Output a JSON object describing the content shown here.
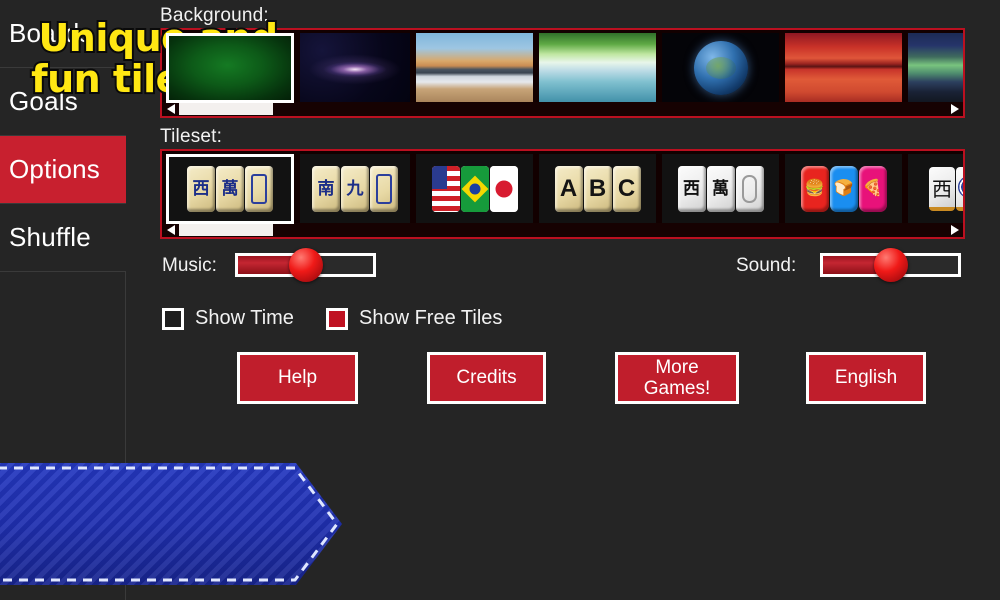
{
  "sidebar": {
    "items": [
      {
        "label": "Boards",
        "selected": false
      },
      {
        "label": "Goals",
        "selected": false
      },
      {
        "label": "Options",
        "selected": true
      },
      {
        "label": "Shuffle",
        "selected": false
      }
    ]
  },
  "background_section": {
    "label": "Background:",
    "selected_index": 0,
    "scroll_left_icon": "left-arrow-icon",
    "scroll_right_icon": "right-arrow-icon",
    "thumbs": [
      {
        "name": "green-felt",
        "style": "bg-green"
      },
      {
        "name": "galaxy",
        "style": "bg-galaxy"
      },
      {
        "name": "beach-sunset",
        "style": "bg-beach"
      },
      {
        "name": "forest-lake",
        "style": "bg-forest"
      },
      {
        "name": "earth-from-space",
        "style": "bg-earth"
      },
      {
        "name": "red-desert",
        "style": "bg-desert"
      },
      {
        "name": "aurora-borealis",
        "style": "bg-aurora"
      }
    ]
  },
  "tileset_section": {
    "label": "Tileset:",
    "selected_index": 0,
    "scroll_left_icon": "left-arrow-icon",
    "scroll_right_icon": "right-arrow-icon",
    "thumbs": [
      {
        "name": "classic-ivory",
        "tiles": [
          "西",
          "萬",
          "▯"
        ]
      },
      {
        "name": "classic-gold",
        "tiles": [
          "南",
          "九",
          "▯"
        ]
      },
      {
        "name": "flags",
        "tiles": [
          "US",
          "BR",
          "JP"
        ]
      },
      {
        "name": "letters-abc",
        "tiles": [
          "A",
          "B",
          "C"
        ]
      },
      {
        "name": "white-modern",
        "tiles": [
          "西",
          "萬",
          "▯"
        ]
      },
      {
        "name": "food-icons",
        "tiles": [
          "burger",
          "bread",
          "pizza"
        ]
      },
      {
        "name": "bold-black-white",
        "tiles": [
          "西",
          "disc"
        ]
      }
    ]
  },
  "music": {
    "label": "Music:",
    "value_percent": 50
  },
  "sound": {
    "label": "Sound:",
    "value_percent": 50
  },
  "checkboxes": [
    {
      "label": "Show Time",
      "checked": false
    },
    {
      "label": "Show Free Tiles",
      "checked": true
    }
  ],
  "buttons": [
    {
      "label": "Help"
    },
    {
      "label": "Credits"
    },
    {
      "label": "More\nGames!"
    },
    {
      "label": "English"
    }
  ],
  "banner": {
    "line1": "Unique and",
    "line2": "fun tilesets!"
  },
  "colors": {
    "accent_red": "#c01e2c",
    "selected_red": "#c8202f",
    "panel_border": "#bb1020",
    "background": "#252525",
    "banner_blue": "#2438c0",
    "banner_text": "#ffe713"
  }
}
